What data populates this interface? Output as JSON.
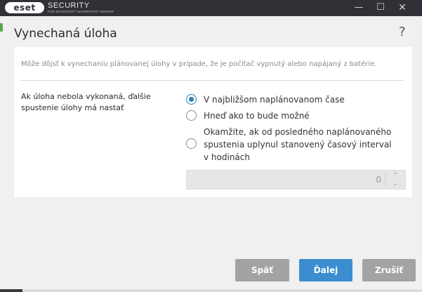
{
  "titlebar": {
    "logo_text": "eset",
    "product": "SECURITY",
    "product_sub": "FOR MICROSOFT SHAREPOINT SERVER",
    "minimize": "—",
    "maximize": "☐",
    "close": "✕"
  },
  "dialog": {
    "title": "Vynechaná úloha",
    "help": "?"
  },
  "content": {
    "description": "Môže dôjsť k vynechaniu plánovanej úlohy v prípade, že je počítač vypnutý alebo napájaný z batérie.",
    "setting_label": "Ak úloha nebola vykonaná, ďalšie spustenie úlohy má nastať",
    "options": [
      {
        "label": "V najbližšom naplánovanom čase",
        "checked": true
      },
      {
        "label": "Hneď ako to bude možné",
        "checked": false
      },
      {
        "label": "Okamžite, ak od posledného naplánovaného spustenia uplynul stanovený časový interval v hodinách",
        "checked": false
      }
    ],
    "interval_value": "0"
  },
  "footer": {
    "back": "Späť",
    "next": "Ďalej",
    "cancel": "Zrušiť"
  },
  "colors": {
    "accent": "#3b8dd0",
    "radio_checked": "#2a7fba",
    "titlebar": "#2f3136",
    "button_disabled": "#a3a3a3"
  }
}
